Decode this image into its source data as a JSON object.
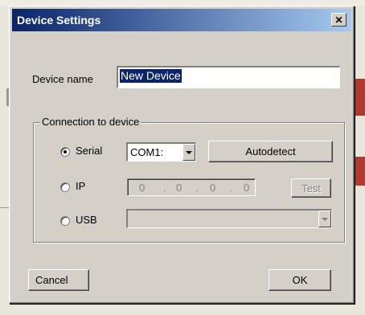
{
  "window": {
    "title": "Device Settings"
  },
  "device_name": {
    "label": "Device name",
    "value": "New Device"
  },
  "connection": {
    "caption": "Connection to device",
    "serial": {
      "label": "Serial",
      "selected": true,
      "port": "COM1:",
      "autodetect_label": "Autodetect"
    },
    "ip": {
      "label": "IP",
      "selected": false,
      "octets": [
        "0",
        ".",
        "0",
        ".",
        "0",
        ".",
        "0"
      ],
      "test_label": "Test"
    },
    "usb": {
      "label": "USB",
      "selected": false,
      "value": ""
    }
  },
  "buttons": {
    "cancel": "Cancel",
    "ok": "OK"
  },
  "icons": {
    "close": "close-icon",
    "dropdown": "chevron-down-icon"
  }
}
